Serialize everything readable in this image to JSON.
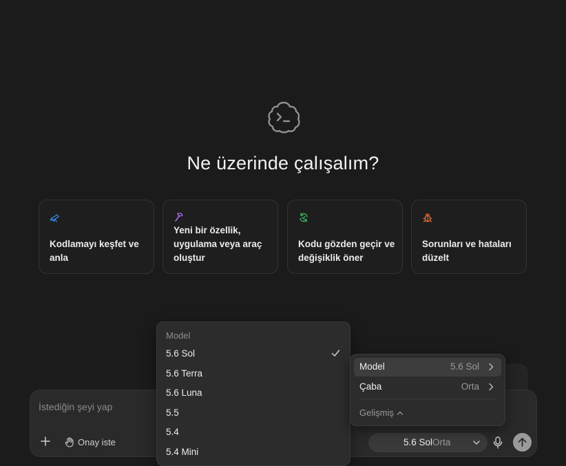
{
  "main": {
    "title": "Ne üzerinde çalışalım?",
    "logo_icon": "terminal-cloud-icon"
  },
  "cards": [
    {
      "icon": "telescope-icon",
      "icon_color": "#3b8beb",
      "label": "Kodlamayı keşfet ve anla"
    },
    {
      "icon": "hammer-icon",
      "icon_color": "#a66df0",
      "label": "Yeni bir özellik, uygulama veya araç oluştur"
    },
    {
      "icon": "review-cycle-icon",
      "icon_color": "#3fbf6a",
      "label": "Kodu gözden geçir ve değişiklik öner"
    },
    {
      "icon": "bug-icon",
      "icon_color": "#f0702c",
      "label": "Sorunları ve hataları düzelt"
    }
  ],
  "composer": {
    "placeholder": "İstediğin şeyi yap",
    "approval_label": "Onay iste",
    "model_value": "5.6 Sol",
    "effort_value": "Orta"
  },
  "model_dropdown": {
    "header": "Model",
    "items": [
      {
        "label": "5.6 Sol",
        "selected": true
      },
      {
        "label": "5.6 Terra",
        "selected": false
      },
      {
        "label": "5.6 Luna",
        "selected": false
      },
      {
        "label": "5.5",
        "selected": false
      },
      {
        "label": "5.4",
        "selected": false
      },
      {
        "label": "5.4 Mini",
        "selected": false
      }
    ]
  },
  "settings_menu": {
    "rows": [
      {
        "label": "Model",
        "value": "5.6 Sol",
        "active": true
      },
      {
        "label": "Çaba",
        "value": "Orta",
        "active": false
      }
    ],
    "advanced_label": "Gelişmiş"
  }
}
